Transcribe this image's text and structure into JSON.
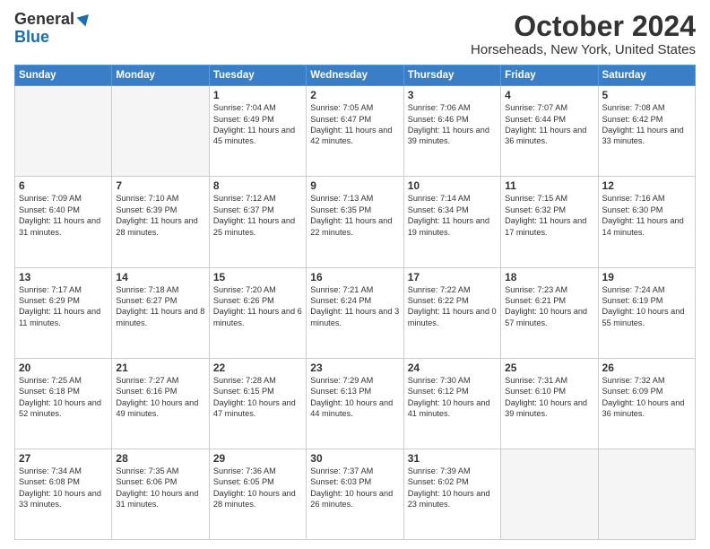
{
  "logo": {
    "general": "General",
    "blue": "Blue"
  },
  "header": {
    "month": "October 2024",
    "location": "Horseheads, New York, United States"
  },
  "weekdays": [
    "Sunday",
    "Monday",
    "Tuesday",
    "Wednesday",
    "Thursday",
    "Friday",
    "Saturday"
  ],
  "weeks": [
    [
      {
        "day": "",
        "info": ""
      },
      {
        "day": "",
        "info": ""
      },
      {
        "day": "1",
        "info": "Sunrise: 7:04 AM\nSunset: 6:49 PM\nDaylight: 11 hours and 45 minutes."
      },
      {
        "day": "2",
        "info": "Sunrise: 7:05 AM\nSunset: 6:47 PM\nDaylight: 11 hours and 42 minutes."
      },
      {
        "day": "3",
        "info": "Sunrise: 7:06 AM\nSunset: 6:46 PM\nDaylight: 11 hours and 39 minutes."
      },
      {
        "day": "4",
        "info": "Sunrise: 7:07 AM\nSunset: 6:44 PM\nDaylight: 11 hours and 36 minutes."
      },
      {
        "day": "5",
        "info": "Sunrise: 7:08 AM\nSunset: 6:42 PM\nDaylight: 11 hours and 33 minutes."
      }
    ],
    [
      {
        "day": "6",
        "info": "Sunrise: 7:09 AM\nSunset: 6:40 PM\nDaylight: 11 hours and 31 minutes."
      },
      {
        "day": "7",
        "info": "Sunrise: 7:10 AM\nSunset: 6:39 PM\nDaylight: 11 hours and 28 minutes."
      },
      {
        "day": "8",
        "info": "Sunrise: 7:12 AM\nSunset: 6:37 PM\nDaylight: 11 hours and 25 minutes."
      },
      {
        "day": "9",
        "info": "Sunrise: 7:13 AM\nSunset: 6:35 PM\nDaylight: 11 hours and 22 minutes."
      },
      {
        "day": "10",
        "info": "Sunrise: 7:14 AM\nSunset: 6:34 PM\nDaylight: 11 hours and 19 minutes."
      },
      {
        "day": "11",
        "info": "Sunrise: 7:15 AM\nSunset: 6:32 PM\nDaylight: 11 hours and 17 minutes."
      },
      {
        "day": "12",
        "info": "Sunrise: 7:16 AM\nSunset: 6:30 PM\nDaylight: 11 hours and 14 minutes."
      }
    ],
    [
      {
        "day": "13",
        "info": "Sunrise: 7:17 AM\nSunset: 6:29 PM\nDaylight: 11 hours and 11 minutes."
      },
      {
        "day": "14",
        "info": "Sunrise: 7:18 AM\nSunset: 6:27 PM\nDaylight: 11 hours and 8 minutes."
      },
      {
        "day": "15",
        "info": "Sunrise: 7:20 AM\nSunset: 6:26 PM\nDaylight: 11 hours and 6 minutes."
      },
      {
        "day": "16",
        "info": "Sunrise: 7:21 AM\nSunset: 6:24 PM\nDaylight: 11 hours and 3 minutes."
      },
      {
        "day": "17",
        "info": "Sunrise: 7:22 AM\nSunset: 6:22 PM\nDaylight: 11 hours and 0 minutes."
      },
      {
        "day": "18",
        "info": "Sunrise: 7:23 AM\nSunset: 6:21 PM\nDaylight: 10 hours and 57 minutes."
      },
      {
        "day": "19",
        "info": "Sunrise: 7:24 AM\nSunset: 6:19 PM\nDaylight: 10 hours and 55 minutes."
      }
    ],
    [
      {
        "day": "20",
        "info": "Sunrise: 7:25 AM\nSunset: 6:18 PM\nDaylight: 10 hours and 52 minutes."
      },
      {
        "day": "21",
        "info": "Sunrise: 7:27 AM\nSunset: 6:16 PM\nDaylight: 10 hours and 49 minutes."
      },
      {
        "day": "22",
        "info": "Sunrise: 7:28 AM\nSunset: 6:15 PM\nDaylight: 10 hours and 47 minutes."
      },
      {
        "day": "23",
        "info": "Sunrise: 7:29 AM\nSunset: 6:13 PM\nDaylight: 10 hours and 44 minutes."
      },
      {
        "day": "24",
        "info": "Sunrise: 7:30 AM\nSunset: 6:12 PM\nDaylight: 10 hours and 41 minutes."
      },
      {
        "day": "25",
        "info": "Sunrise: 7:31 AM\nSunset: 6:10 PM\nDaylight: 10 hours and 39 minutes."
      },
      {
        "day": "26",
        "info": "Sunrise: 7:32 AM\nSunset: 6:09 PM\nDaylight: 10 hours and 36 minutes."
      }
    ],
    [
      {
        "day": "27",
        "info": "Sunrise: 7:34 AM\nSunset: 6:08 PM\nDaylight: 10 hours and 33 minutes."
      },
      {
        "day": "28",
        "info": "Sunrise: 7:35 AM\nSunset: 6:06 PM\nDaylight: 10 hours and 31 minutes."
      },
      {
        "day": "29",
        "info": "Sunrise: 7:36 AM\nSunset: 6:05 PM\nDaylight: 10 hours and 28 minutes."
      },
      {
        "day": "30",
        "info": "Sunrise: 7:37 AM\nSunset: 6:03 PM\nDaylight: 10 hours and 26 minutes."
      },
      {
        "day": "31",
        "info": "Sunrise: 7:39 AM\nSunset: 6:02 PM\nDaylight: 10 hours and 23 minutes."
      },
      {
        "day": "",
        "info": ""
      },
      {
        "day": "",
        "info": ""
      }
    ]
  ]
}
